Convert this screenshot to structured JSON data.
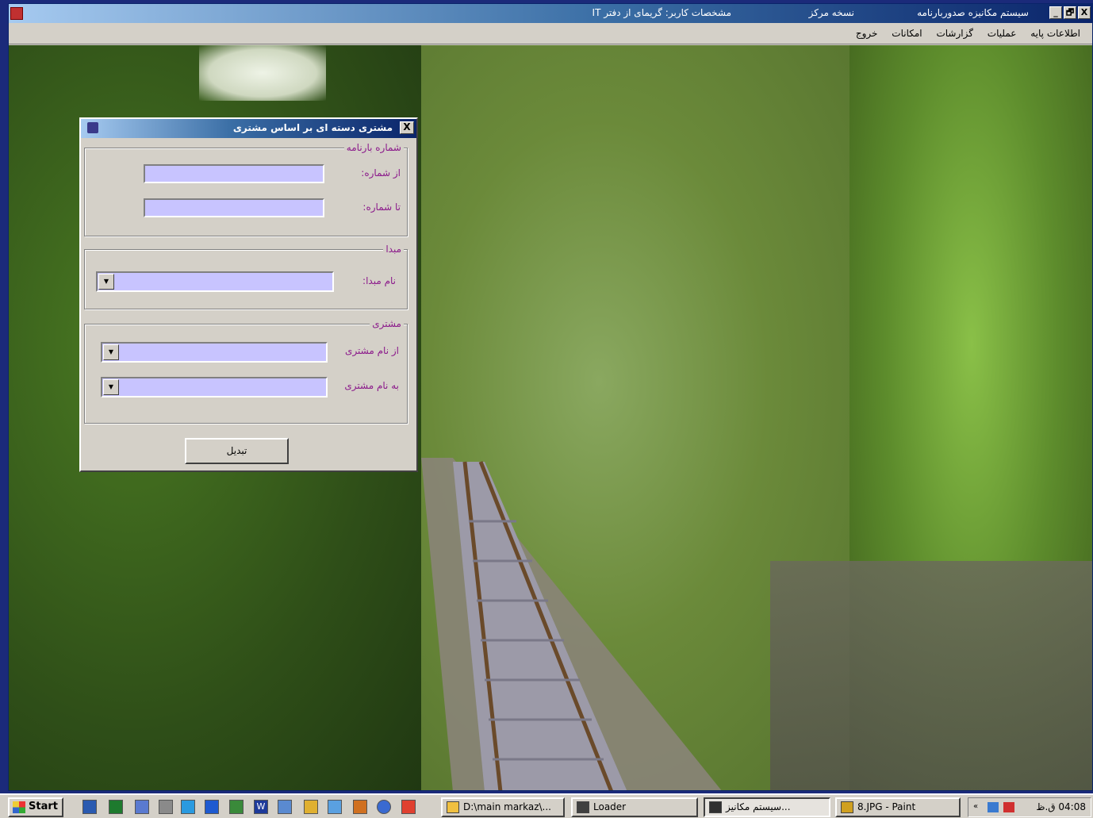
{
  "app": {
    "title": "سیستم مکانیزه صدوربارنامه",
    "branch": "نسخه مرکز",
    "user_info": "مشخصات کاربر: گریمای از دفتر IT",
    "controls": {
      "close": "X",
      "restore": "🗗",
      "minimize": "_"
    }
  },
  "menu": {
    "items": [
      "اطلاعات پایه",
      "عملیات",
      "گزارشات",
      "امکانات",
      "خروج"
    ]
  },
  "dialog": {
    "title": "مشتری دسته ای بر اساس مشتری",
    "close_label": "X",
    "group_bill": {
      "legend": "شماره بارنامه",
      "from_label": "از شماره:",
      "from_value": "",
      "to_label": "تا شماره:",
      "to_value": ""
    },
    "group_origin": {
      "legend": "مبدا",
      "name_label": "نام مبدا:",
      "name_value": ""
    },
    "group_customer": {
      "legend": "مشتری",
      "from_label": "از نام مشتری",
      "from_value": "",
      "to_label": "به نام مشتری",
      "to_value": ""
    },
    "submit_label": "تبدیل"
  },
  "taskbar": {
    "start_label": "Start",
    "quick_launch_icons": [
      "outlook-icon",
      "excel-icon",
      "notepad-icon",
      "network-icon",
      "messenger-icon",
      "ie-icon",
      "tree-icon",
      "word-icon",
      "explorer-icon",
      "folder-icon",
      "sync-icon",
      "java-icon",
      "media-icon",
      "paint-icon"
    ],
    "tasks": [
      {
        "label": "D:\\main markaz\\...",
        "icon": "folder-icon",
        "color": "#f0c040"
      },
      {
        "label": "Loader",
        "icon": "app-icon",
        "color": "#404040"
      },
      {
        "label": "سیستم مکانیز...",
        "icon": "app-icon",
        "color": "#303030",
        "active": true
      },
      {
        "label": "8.JPG - Paint",
        "icon": "paint-icon",
        "color": "#d0a020"
      }
    ],
    "clock": "04:08 ق.ظ",
    "tray_icons": [
      "collapse-icon",
      "network-icon",
      "volume-icon"
    ]
  }
}
